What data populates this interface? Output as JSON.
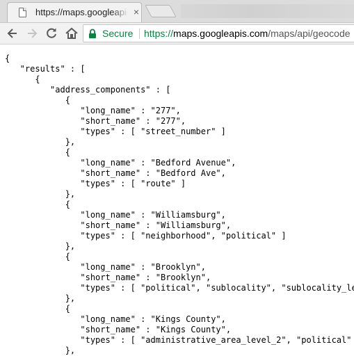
{
  "tab": {
    "title": "https://maps.googleapis",
    "close_symbol": "×",
    "favicon_icon": "document-icon"
  },
  "toolbar": {
    "icons": [
      "back-arrow-icon",
      "forward-arrow-icon",
      "reload-icon",
      "home-icon"
    ],
    "secure_label": "Secure",
    "url_scheme": "https://",
    "url_host": "maps.googleapis.com",
    "url_path": "/maps/api/geocode",
    "secure_color": "#0b8043"
  },
  "json_lines": [
    {
      "text": "{"
    },
    {
      "text": "   \"results\" : ["
    },
    {
      "text": "      {"
    },
    {
      "text": "         \"address_components\" : ["
    },
    {
      "text": "            {"
    },
    {
      "text": "               \"long_name\" : \"277\","
    },
    {
      "text": "               \"short_name\" : \"277\","
    },
    {
      "text": "               \"types\" : [ \"street_number\" ]"
    },
    {
      "text": "            },"
    },
    {
      "text": "            {"
    },
    {
      "text": "               \"long_name\" : \"Bedford Avenue\","
    },
    {
      "text": "               \"short_name\" : \"Bedford Ave\","
    },
    {
      "text": "               \"types\" : [ \"route\" ]"
    },
    {
      "text": "            },"
    },
    {
      "text": "            {"
    },
    {
      "text": "               \"long_name\" : \"Williamsburg\","
    },
    {
      "text": "               \"short_name\" : \"Williamsburg\","
    },
    {
      "text": "               \"types\" : [ \"neighborhood\", \"political\" ]"
    },
    {
      "text": "            },"
    },
    {
      "text": "            {"
    },
    {
      "text": "               \"long_name\" : \"Brooklyn\","
    },
    {
      "text": "               \"short_name\" : \"Brooklyn\","
    },
    {
      "text": "               \"types\" : [ \"political\", \"sublocality\", \"sublocality_le"
    },
    {
      "text": "            },"
    },
    {
      "text": "            {"
    },
    {
      "text": "               \"long_name\" : \"Kings County\","
    },
    {
      "text": "               \"short_name\" : \"Kings County\","
    },
    {
      "text": "               \"types\" : [ \"administrative_area_level_2\", \"political\""
    },
    {
      "text": "            },"
    }
  ]
}
